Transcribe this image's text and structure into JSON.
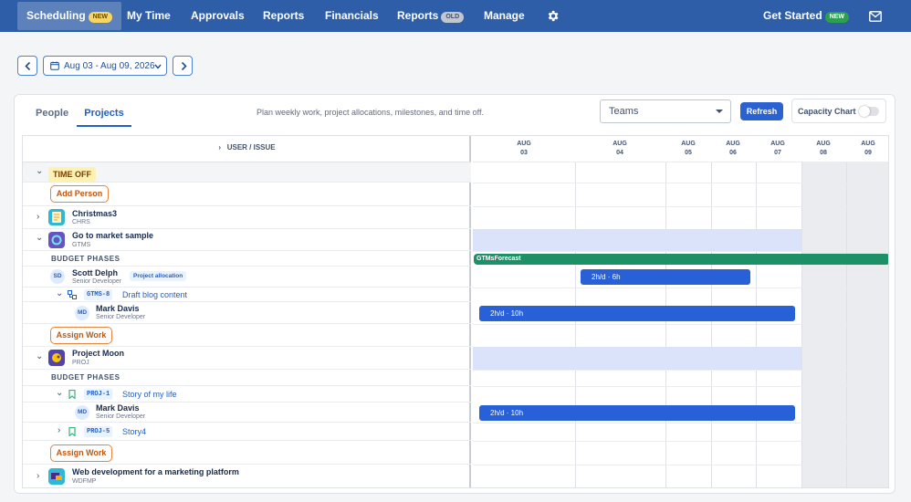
{
  "nav": {
    "scheduling": "Scheduling",
    "scheduling_badge": "NEW",
    "my_time": "My Time",
    "approvals": "Approvals",
    "reports": "Reports",
    "financials": "Financials",
    "reports_old": "Reports",
    "reports_old_badge": "OLD",
    "manage": "Manage",
    "get_started": "Get Started",
    "get_started_badge": "NEW",
    "settings_icon": "gear-icon",
    "mail_icon": "mail-icon"
  },
  "date_range": "Aug 03 - Aug 09, 2026",
  "tabs": {
    "people": "People",
    "projects": "Projects"
  },
  "tab_description": "Plan weekly work, project allocations, milestones, and time off.",
  "teams_select": "Teams",
  "refresh_label": "Refresh",
  "capacity_chart_label": "Capacity Chart",
  "capacity_chart_on": false,
  "grid": {
    "header_label": "USER / ISSUE",
    "days": [
      {
        "month": "AUG",
        "day": "03",
        "weekend": false
      },
      {
        "month": "AUG",
        "day": "04",
        "weekend": false
      },
      {
        "month": "AUG",
        "day": "05",
        "weekend": false
      },
      {
        "month": "AUG",
        "day": "06",
        "weekend": false
      },
      {
        "month": "AUG",
        "day": "07",
        "weekend": false
      },
      {
        "month": "AUG",
        "day": "08",
        "weekend": true
      },
      {
        "month": "AUG",
        "day": "09",
        "weekend": true
      }
    ],
    "time_off": "TIME OFF",
    "add_person": "Add Person",
    "projects": [
      {
        "name": "Christmas3",
        "key": "CHRS"
      },
      {
        "name": "Go to market sample",
        "key": "GTMS"
      },
      {
        "name": "Project Moon",
        "key": "PROJ"
      },
      {
        "name": "Web development for a marketing platform",
        "key": "WDFMP"
      }
    ],
    "budget_phases": "BUDGET PHASES",
    "gtms": {
      "forecast": "GTMsForecast",
      "person": {
        "initials": "SD",
        "name": "Scott Delph",
        "role": "Senior Developer",
        "tag": "Project allocation",
        "allocation": "2h/d · 6h"
      },
      "issue": {
        "key": "GTMS-8",
        "title": "Draft blog content"
      },
      "assignee": {
        "initials": "MD",
        "name": "Mark Davis",
        "role": "Senior Developer",
        "allocation": "2h/d · 10h"
      }
    },
    "assign_work": "Assign Work",
    "proj": {
      "issue1": {
        "key": "PROJ-1",
        "title": "Story of my life"
      },
      "assignee": {
        "initials": "MD",
        "name": "Mark Davis",
        "role": "Senior Developer",
        "allocation": "2h/d · 10h"
      },
      "issue2": {
        "key": "PROJ-5",
        "title": "Story4"
      }
    }
  }
}
